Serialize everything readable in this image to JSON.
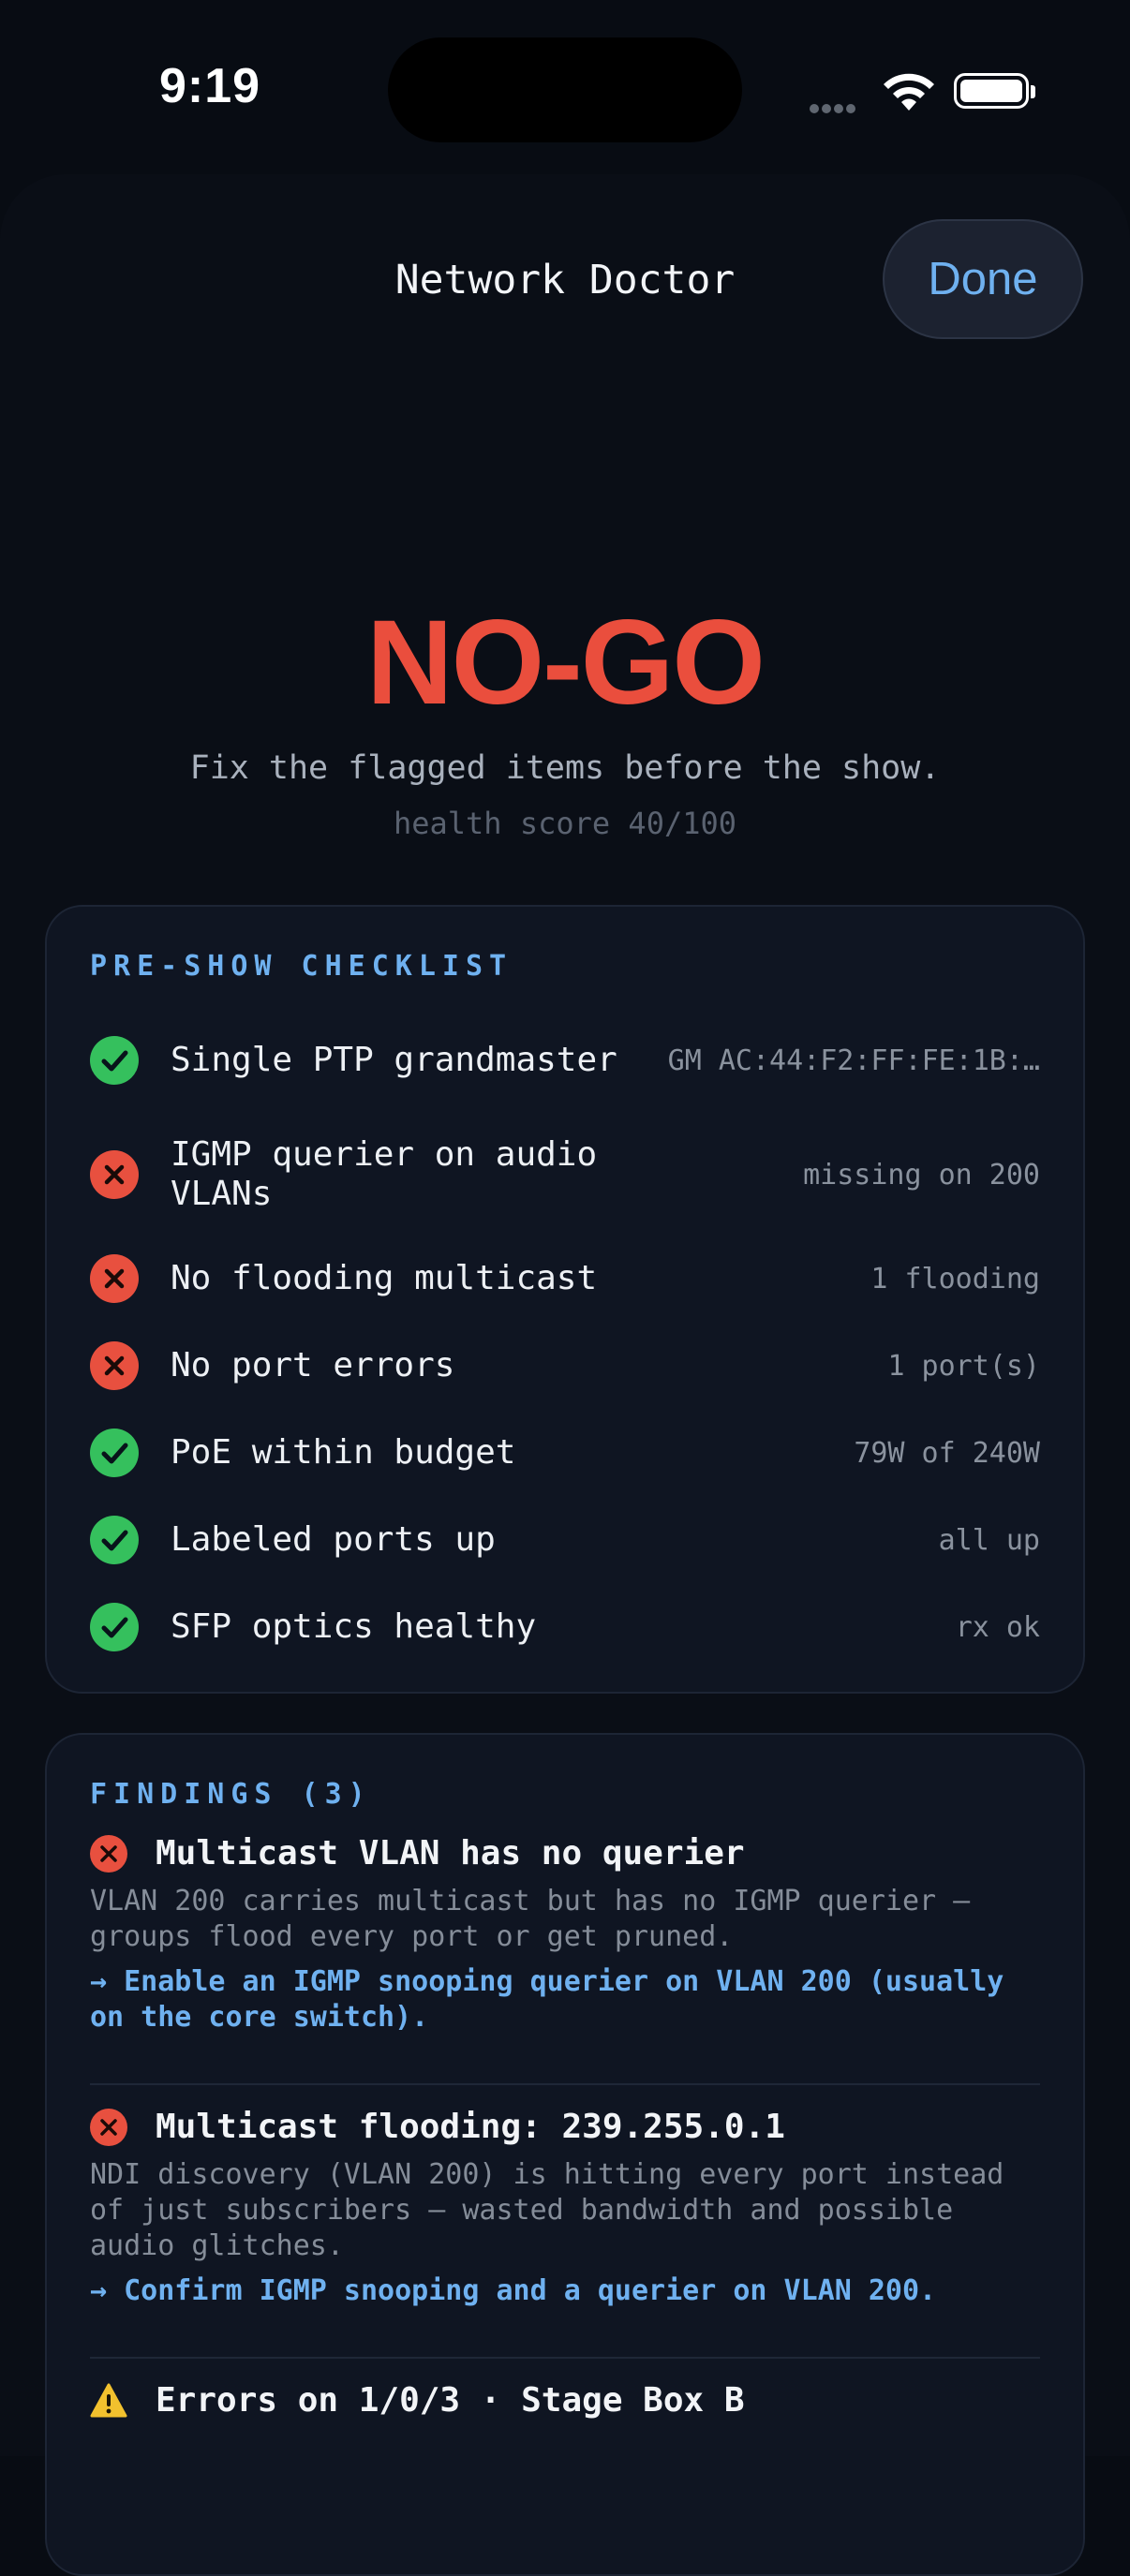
{
  "status_bar": {
    "time": "9:19"
  },
  "sheet": {
    "title": "Network Doctor",
    "done_label": "Done"
  },
  "verdict": {
    "label": "NO-GO",
    "message": "Fix the flagged items before the show.",
    "score": "health score 40/100",
    "color": "#ea4e3d"
  },
  "checklist": {
    "heading": "PRE-SHOW CHECKLIST",
    "items": [
      {
        "label": "Single PTP grandmaster",
        "value": "GM AC:44:F2:FF:FE:1B:…",
        "status": "ok"
      },
      {
        "label": "IGMP querier on audio VLANs",
        "value": "missing on 200",
        "status": "fail"
      },
      {
        "label": "No flooding multicast",
        "value": "1 flooding",
        "status": "fail"
      },
      {
        "label": "No port errors",
        "value": "1 port(s)",
        "status": "fail"
      },
      {
        "label": "PoE within budget",
        "value": "79W of 240W",
        "status": "ok"
      },
      {
        "label": "Labeled ports up",
        "value": "all up",
        "status": "ok"
      },
      {
        "label": "SFP optics healthy",
        "value": "rx ok",
        "status": "ok"
      }
    ]
  },
  "findings": {
    "heading": "FINDINGS (3)",
    "items": [
      {
        "severity": "error",
        "title": "Multicast VLAN has no querier",
        "description": "VLAN 200 carries multicast but has no IGMP querier — groups flood every port or get pruned.",
        "action": "→ Enable an IGMP snooping querier on VLAN 200 (usually on the core switch)."
      },
      {
        "severity": "error",
        "title": "Multicast flooding: 239.255.0.1",
        "description": "NDI discovery (VLAN 200) is hitting every port instead of just subscribers — wasted bandwidth and possible audio glitches.",
        "action": "→ Confirm IGMP snooping and a querier on VLAN 200."
      },
      {
        "severity": "warning",
        "title": "Errors on 1/0/3 · Stage Box B",
        "description": "",
        "action": ""
      }
    ]
  },
  "colors": {
    "ok": "#35c05d",
    "fail": "#e8503f",
    "warning": "#f2c12e",
    "accent": "#6fb1f0"
  }
}
